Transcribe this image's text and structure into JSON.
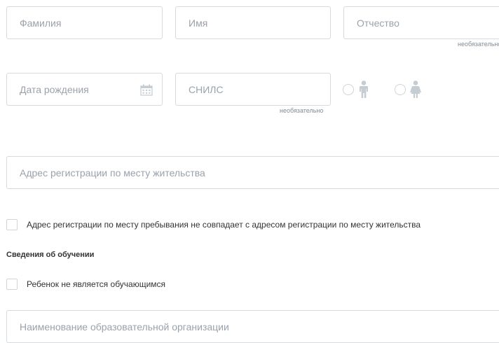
{
  "form": {
    "last_name": {
      "placeholder": "Фамилия"
    },
    "first_name": {
      "placeholder": "Имя"
    },
    "patronymic": {
      "placeholder": "Отчество",
      "note": "необязательно"
    },
    "birth_date": {
      "placeholder": "Дата рождения",
      "icon": "calendar-icon"
    },
    "snils": {
      "placeholder": "СНИЛС",
      "note": "необязательно"
    },
    "gender": {
      "options": [
        {
          "icon": "male-child-icon"
        },
        {
          "icon": "female-child-icon"
        }
      ]
    },
    "residence_address": {
      "placeholder": "Адрес регистрации по месту жительства"
    },
    "stay_address_checkbox": {
      "label": "Адрес регистрации по месту пребывания не совпадает с адресом регистрации по месту жительства"
    },
    "education_section": {
      "title": "Сведения об обучении"
    },
    "not_student_checkbox": {
      "label": "Ребенок не является обучающимся"
    },
    "school_name": {
      "placeholder": "Наименование образовательной организации"
    }
  },
  "colors": {
    "border": "#d6dbe0",
    "placeholder": "#9aa2ab",
    "icon": "#c5ccd2"
  }
}
